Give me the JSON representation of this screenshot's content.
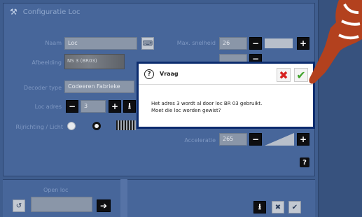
{
  "window": {
    "title": "Configuratie Loc"
  },
  "form": {
    "name_label": "Naam",
    "name_value": "Loc",
    "image_label": "Afbeelding",
    "loco_image_text": "NS 3 (BR03)",
    "decoder_type_label": "Decoder type",
    "decoder_value": "Codeeren Fabrieke",
    "address_label": "Loc adres",
    "address_value": "3",
    "direction_label": "Rijrichting / Licht",
    "max_speed_label": "Max. snelheid",
    "max_speed_value": "26",
    "accel_label": "Acceleratie",
    "accel_value": "265"
  },
  "dialog": {
    "title": "Vraag",
    "message_line1": "Het adres 3 wordt al door loc BR 03 gebruikt.",
    "message_line2": "Moet die loc worden gewist?"
  },
  "bottom": {
    "label": "Open loc"
  },
  "icons": {
    "wrench": "wrench-icon",
    "question": "question-icon",
    "close": "close-icon",
    "check": "check-icon",
    "keyboard": "keyboard-icon",
    "minus": "minus-icon",
    "plus": "plus-icon",
    "download": "download-icon",
    "arrow": "arrow-right-icon"
  },
  "colors": {
    "background": "#3f5d8e",
    "dialog_border": "#0c2c6e",
    "cancel_red": "#d6211f",
    "ok_green": "#3fa22a",
    "hand_brown": "#b3411e"
  }
}
